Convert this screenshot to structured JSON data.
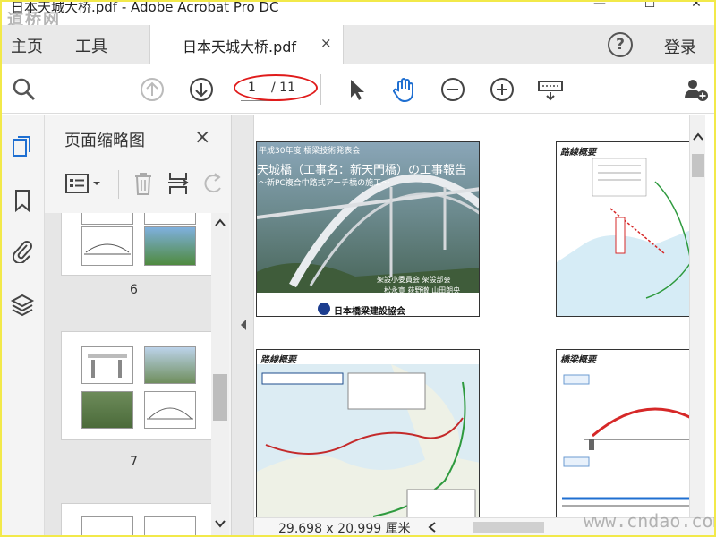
{
  "window": {
    "title": "日本天城大桥.pdf - Adobe Acrobat Pro DC",
    "watermark_top": "道桥网",
    "watermark_bottom": "www.cndao.com"
  },
  "menu": {
    "home": "主页",
    "tools": "工具",
    "tab_label": "日本天城大桥.pdf",
    "tab_close": "×",
    "help": "?",
    "login": "登录"
  },
  "toolbar": {
    "page_current": "1",
    "page_total": "/ 11",
    "icons": [
      "search-icon",
      "prev-page-icon",
      "next-page-icon",
      "cursor-icon",
      "hand-icon",
      "zoom-out-icon",
      "zoom-in-icon",
      "keyboard-icon",
      "add-user-icon"
    ]
  },
  "sidebar": {
    "panel_title": "页面缩略图",
    "close": "×",
    "thumbnails": [
      {
        "page": "6"
      },
      {
        "page": "7"
      }
    ]
  },
  "document": {
    "page1": {
      "line1": "平成30年度 橋梁技術発表会",
      "line2": "天城橋（工事名：新天門橋）の工事報告",
      "line3": "～新PC複合中路式アーチ橋の施工～",
      "authors1": "架設小委員会 架設部会",
      "authors2": "松永寛  荻野徹  山田朗央",
      "org": "日本橋梁建設協会"
    },
    "page2_title": "路線概要",
    "page3_title": "路線概要",
    "page4_title": "橋梁概要"
  },
  "status": {
    "dimensions": "29.698 x 20.999 厘米"
  },
  "colors": {
    "highlight_oval": "#e01b1b",
    "accent_blue": "#1f6fd1",
    "outer_border": "#f2e94a"
  }
}
